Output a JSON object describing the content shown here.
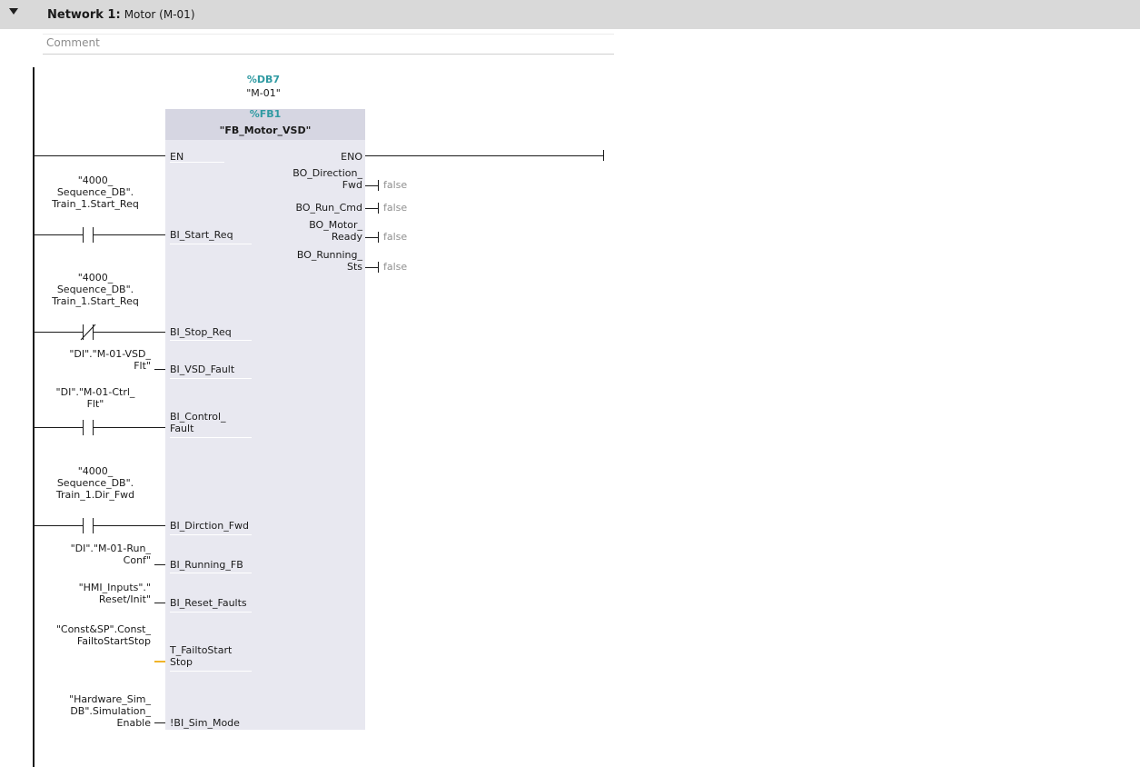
{
  "network": {
    "label": "Network 1:",
    "name": "Motor (M-01)",
    "comment_placeholder": "Comment"
  },
  "block": {
    "db_address": "%DB7",
    "db_name": "\"M-01\"",
    "fb_address": "%FB1",
    "fb_name": "\"FB_Motor_VSD\""
  },
  "inputs": {
    "en": "EN",
    "start_req": "BI_Start_Req",
    "stop_req": "BI_Stop_Req",
    "vsd_fault": "BI_VSD_Fault",
    "control_fault_1": "BI_Control_",
    "control_fault_2": "Fault",
    "direction_fwd": "BI_Dirction_Fwd",
    "running_fb": "BI_Running_FB",
    "reset_faults": "BI_Reset_Faults",
    "fail_to_start_1": "T_FailtoStart",
    "fail_to_start_2": "Stop",
    "sim_mode": "!BI_Sim_Mode"
  },
  "outputs": {
    "eno": "ENO",
    "direction_fwd_1": "BO_Direction_",
    "direction_fwd_2": "Fwd",
    "run_cmd": "BO_Run_Cmd",
    "motor_ready_1": "BO_Motor_",
    "motor_ready_2": "Ready",
    "running_sts_1": "BO_Running_",
    "running_sts_2": "Sts",
    "false_value": "false"
  },
  "operands": {
    "start_req": [
      "\"4000_",
      "Sequence_DB\".",
      "Train_1.Start_Req"
    ],
    "stop_req": [
      "\"4000_",
      "Sequence_DB\".",
      "Train_1.Start_Req"
    ],
    "vsd_fault": [
      "\"DI\".\"M-01-VSD_",
      "Flt\""
    ],
    "control_fault": [
      "\"DI\".\"M-01-Ctrl_",
      "Flt\""
    ],
    "direction_fwd": [
      "\"4000_",
      "Sequence_DB\".",
      "Train_1.Dir_Fwd"
    ],
    "running_fb": [
      "\"DI\".\"M-01-Run_",
      "Conf\""
    ],
    "reset_faults": [
      "\"HMI_Inputs\".\"",
      "Reset/Init\""
    ],
    "fail_to_start": [
      "\"Const&SP\".Const_",
      "FailtoStartStop"
    ],
    "sim_mode": [
      "\"Hardware_Sim_",
      "DB\".Simulation_",
      "Enable"
    ]
  },
  "colors": {
    "header_bg": "#d9d9d9",
    "block_bg": "#e8e8f0",
    "address_teal": "#2f9aa2",
    "time_wire": "#f0b429",
    "value_gray": "#8f8f8f"
  }
}
